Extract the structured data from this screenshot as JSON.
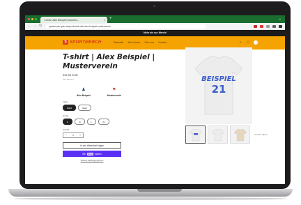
{
  "browser": {
    "tab_title": "T-shirt | Alex Beispiel | Musterv...",
    "tab_close": "×",
    "new_tab": "+",
    "window_chevron": "⌄",
    "url": "sportmerch.gdsn.de/products/t-shirt-alex-beispiel-musterverein",
    "nav_back": "←",
    "nav_forward": "→",
    "nav_reload": "↻",
    "ext_colors": [
      "#c62828",
      "#e53935",
      "#9e9e9e",
      "#616161",
      "#333333"
    ]
  },
  "announcement": "Mehr als nur Merch!",
  "header": {
    "logo_mark": "S",
    "logo_text": "SPORTMERCH",
    "menu": [
      "Startseite",
      "Alle Vereine",
      "Über uns",
      "Kontakt"
    ],
    "icons": [
      "search-icon",
      "account-icon",
      "cart-icon"
    ],
    "search_glyph": "⌕",
    "account_glyph": "⚇"
  },
  "product": {
    "title": "T-shirt | Alex Beispiel | Musterverein",
    "price": "€32,90 EUR",
    "tax_note": "inkl. Steuern",
    "players": [
      {
        "label": "Alex Beispiel",
        "glyph": "♟"
      },
      {
        "label": "Musterverein",
        "glyph": "⚑"
      }
    ],
    "color_label": "Farbe",
    "colors": [
      "Weiß",
      "Natur"
    ],
    "selected_color": "Weiß",
    "size_label": "Größe",
    "sizes": [
      "S",
      "M",
      "L",
      "XL"
    ],
    "selected_size": "S",
    "qty_label": "Anzahl",
    "qty": {
      "minus": "−",
      "value": "1",
      "plus": "+"
    },
    "add_to_cart": "In den Warenkorb legen",
    "shop_pay_prefix": "Mit",
    "shop_pay_brand": "shop",
    "shop_pay_suffix": "kaufen",
    "more_payment": "Weitere Zahlungsoptionen"
  },
  "media": {
    "shirt_text": "BEISPIEL",
    "shirt_number": "21",
    "shirt_color": "#ececec",
    "print_color": "#3b5ecb",
    "thumb_colors": [
      "#ececec",
      "#ececec",
      "#e6d6bd"
    ],
    "zoom_text": "In Zoom öffnen"
  }
}
